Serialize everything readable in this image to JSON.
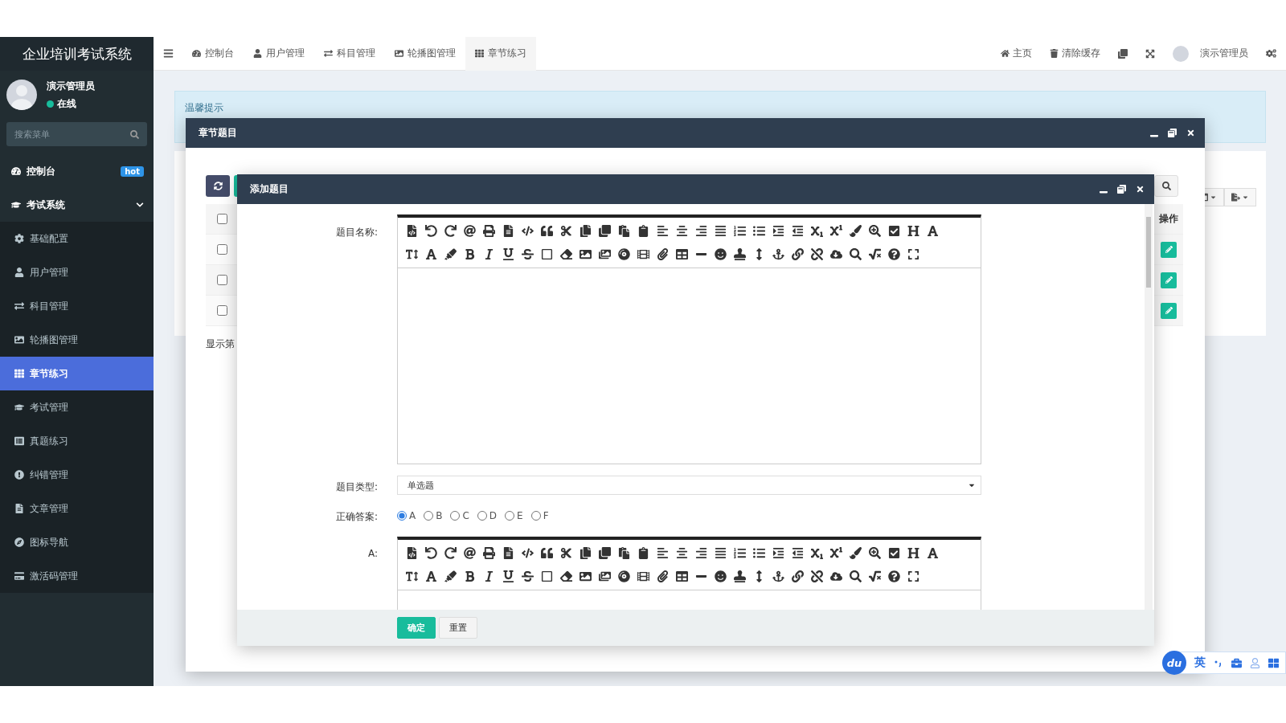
{
  "sidebar": {
    "logo": "企业培训考试系统",
    "user": {
      "name": "演示管理员",
      "status": "在线",
      "online": true
    },
    "search": {
      "placeholder": "搜索菜单"
    },
    "items": [
      {
        "label": "控制台",
        "badge": "hot",
        "selected": false
      },
      {
        "label": "考试系统",
        "selected": false,
        "expanded": true,
        "children": [
          {
            "label": "基础配置",
            "selected": false
          },
          {
            "label": "用户管理",
            "selected": false
          },
          {
            "label": "科目管理",
            "selected": false
          },
          {
            "label": "轮播图管理",
            "selected": false
          },
          {
            "label": "章节练习",
            "selected": true
          },
          {
            "label": "考试管理",
            "selected": false
          },
          {
            "label": "真题练习",
            "selected": false
          },
          {
            "label": "纠错管理",
            "selected": false
          },
          {
            "label": "文章管理",
            "selected": false
          },
          {
            "label": "图标导航",
            "selected": false
          },
          {
            "label": "激活码管理",
            "selected": false
          }
        ]
      }
    ]
  },
  "topbar": {
    "tabs": [
      {
        "label": "控制台",
        "selected": false
      },
      {
        "label": "用户管理",
        "selected": false
      },
      {
        "label": "科目管理",
        "selected": false
      },
      {
        "label": "轮播图管理",
        "selected": false
      },
      {
        "label": "章节练习",
        "selected": true
      }
    ],
    "links": [
      {
        "label": "主页"
      },
      {
        "label": "清除缓存"
      }
    ],
    "user": {
      "name": "演示管理员"
    }
  },
  "notice": {
    "title": "温馨提示"
  },
  "chapter_dialog": {
    "title": "章节题目",
    "table": {
      "header": {
        "checked": false,
        "action": "操作"
      },
      "rows": [
        {
          "checked": false
        },
        {
          "checked": false
        },
        {
          "checked": false
        }
      ]
    },
    "pagination": "显示第"
  },
  "add_dialog": {
    "title": "添加题目",
    "fields": [
      {
        "kind": "editor",
        "label": "题目名称:"
      },
      {
        "kind": "select",
        "label": "题目类型:",
        "value": "单选题"
      },
      {
        "kind": "radio",
        "label": "正确答案:",
        "options": [
          {
            "label": "A",
            "selected": true
          },
          {
            "label": "B",
            "selected": false
          },
          {
            "label": "C",
            "selected": false
          },
          {
            "label": "D",
            "selected": false
          },
          {
            "label": "E",
            "selected": false
          },
          {
            "label": "F",
            "selected": false
          }
        ]
      },
      {
        "kind": "editor",
        "label": "A:"
      }
    ],
    "buttons": [
      {
        "label": "确定",
        "kind": "primary"
      },
      {
        "label": "重置",
        "kind": "default"
      }
    ]
  },
  "ime": {
    "logo": "du",
    "mode": "英"
  }
}
